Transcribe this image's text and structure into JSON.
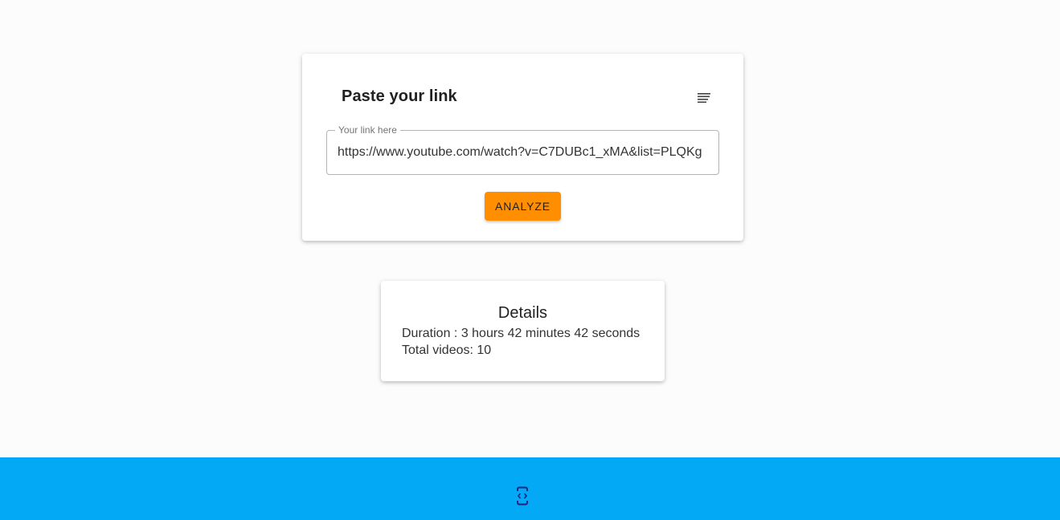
{
  "link_card": {
    "title": "Paste your link",
    "menu_icon": "sort-lines-icon",
    "input": {
      "label": "Your link here",
      "value": "https://www.youtube.com/watch?v=C7DUBc1_xMA&list=PLQKg"
    },
    "analyze_label": "Analyze"
  },
  "details": {
    "title": "Details",
    "duration_text": "Duration : 3 hours 42 minutes 42 seconds",
    "total_videos_text": "Total videos: 10"
  },
  "footer": {
    "icon": "developer-mode-icon"
  },
  "colors": {
    "accent_button": "#ff8f00",
    "footer_bg": "#03a9f4"
  }
}
